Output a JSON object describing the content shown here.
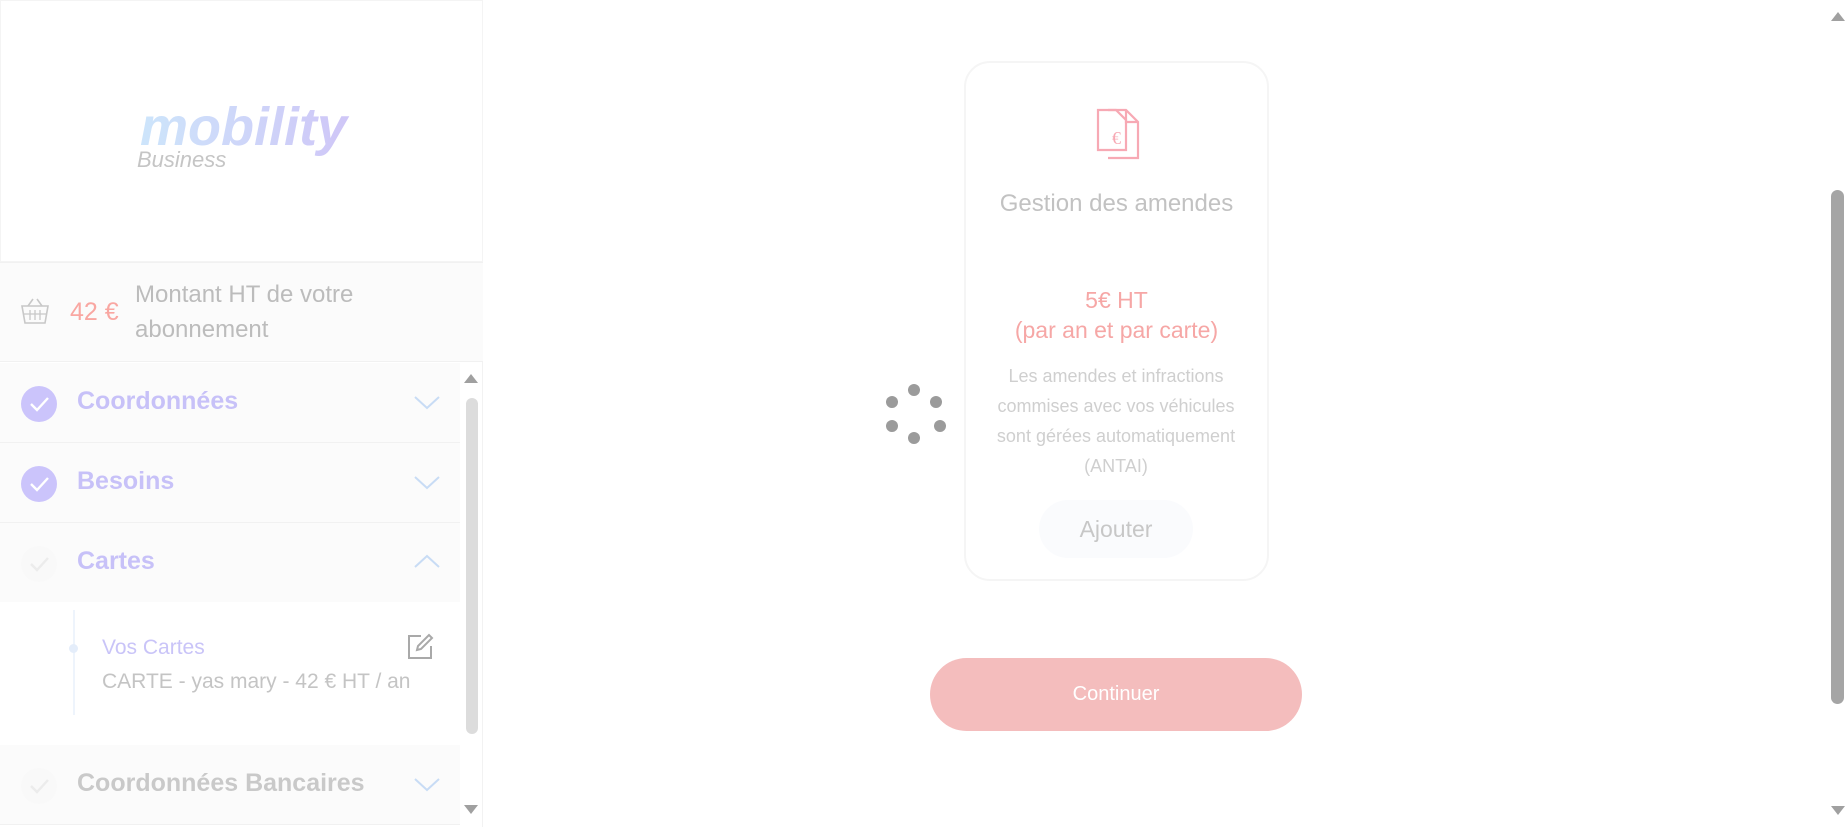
{
  "brand": {
    "logo_main": "mobility",
    "logo_sub": "Business"
  },
  "summary": {
    "amount": "42 €",
    "label": "Montant HT de votre abonnement",
    "basket_icon": "basket-icon"
  },
  "steps": [
    {
      "label": "Coordonnées",
      "status": "done",
      "chevron": "chevron-down-icon"
    },
    {
      "label": "Besoins",
      "status": "done",
      "chevron": "chevron-down-icon"
    },
    {
      "label": "Cartes",
      "status": "current",
      "chevron": "chevron-up-icon"
    },
    {
      "label": "Coordonnées Bancaires",
      "status": "pending",
      "chevron": "chevron-down-icon"
    }
  ],
  "cards_substep": {
    "title": "Vos Cartes",
    "detail": "CARTE - yas mary - 42 € HT / an",
    "edit_icon": "edit-icon"
  },
  "option_card": {
    "icon": "fines-document-icon",
    "icon_symbol": "€",
    "title": "Gestion des amendes",
    "price_line1": "5€ HT",
    "price_line2": "(par an et par carte)",
    "description": "Les amendes et infractions commises avec vos véhicules sont gérées automatiquement (ANTAI)",
    "add_label": "Ajouter"
  },
  "actions": {
    "continue_label": "Continuer"
  },
  "colors": {
    "accent_purple": "#c7c1f8",
    "accent_pink": "#f6a7a6",
    "button_pink": "#f4bdbd"
  }
}
